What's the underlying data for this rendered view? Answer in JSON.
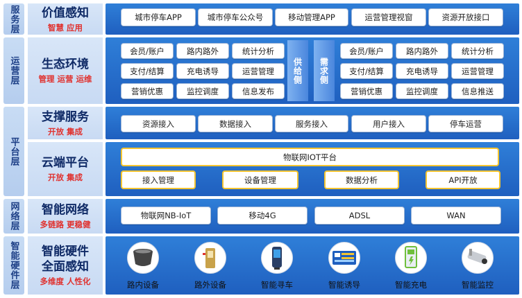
{
  "layers": {
    "service": "服务层",
    "operation": "运营层",
    "platform": "平台层",
    "network": "网络层",
    "hardware": "智能硬件层"
  },
  "rows": {
    "value": {
      "title": "价值感知",
      "sub": "智慧 应用",
      "items": [
        "城市停车APP",
        "城市停车公众号",
        "移动管理APP",
        "运营管理视窗",
        "资源开放接口"
      ]
    },
    "ecosystem": {
      "title": "生态环境",
      "sub": "管理 运营 运维",
      "supply_label": "供给侧",
      "demand_label": "需求侧",
      "left_items": [
        "会员/账户",
        "路内路外",
        "统计分析",
        "支付/结算",
        "充电诱导",
        "运营管理",
        "营销优惠",
        "监控调度",
        "信息发布"
      ],
      "right_items": [
        "会员/账户",
        "路内路外",
        "统计分析",
        "支付/结算",
        "充电诱导",
        "运营管理",
        "营销优惠",
        "监控调度",
        "信息推送"
      ]
    },
    "support": {
      "title": "支撑服务",
      "sub": "开放 集成",
      "items": [
        "资源接入",
        "数据接入",
        "服务接入",
        "用户接入",
        "停车运营"
      ]
    },
    "cloud": {
      "title": "云端平台",
      "sub": "开放 集成",
      "platform": "物联网IOT平台",
      "items": [
        "接入管理",
        "设备管理",
        "数据分析",
        "API开放"
      ]
    },
    "network": {
      "title": "智能网络",
      "sub": "多链路 更稳健",
      "items": [
        "物联网NB-IoT",
        "移动4G",
        "ADSL",
        "WAN"
      ]
    },
    "hardware": {
      "title": "智能硬件",
      "title2": "全面感知",
      "sub": "多维度 人性化",
      "devices": [
        {
          "label": "路内设备",
          "icon": "roadside-sensor-icon"
        },
        {
          "label": "路外设备",
          "icon": "barrier-gate-icon"
        },
        {
          "label": "智能寻车",
          "icon": "car-finder-kiosk-icon"
        },
        {
          "label": "智能诱导",
          "icon": "guidance-screen-icon"
        },
        {
          "label": "智能充电",
          "icon": "charging-pile-icon"
        },
        {
          "label": "智能监控",
          "icon": "surveillance-camera-icon"
        }
      ]
    }
  },
  "colors": {
    "panel_blue": "#2060c4",
    "accent_red": "#e0322f",
    "title_navy": "#0f2a66",
    "yellow_border": "#f4c430"
  }
}
